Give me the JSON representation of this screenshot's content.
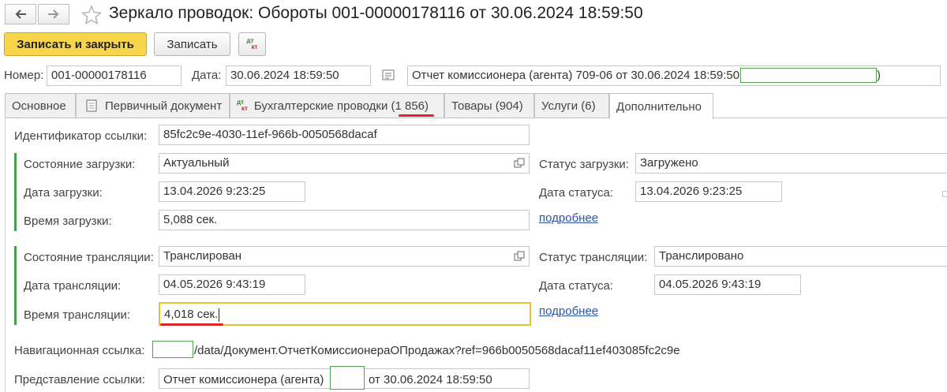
{
  "window": {
    "title": "Зеркало проводок: Обороты 001-00000178116 от 30.06.2024 18:59:50"
  },
  "toolbar": {
    "save_close_label": "Записать и закрыть",
    "save_label": "Записать",
    "dtkt_top": "дт",
    "dtkt_bottom": "кт"
  },
  "header": {
    "number_label": "Номер:",
    "number_value": "001-00000178116",
    "date_label": "Дата:",
    "date_value": "30.06.2024 18:59:50",
    "basis_value": "Отчет комиссионера (агента) 709-06 от 30.06.2024 18:59:50",
    "basis_suffix": ")"
  },
  "tabs": [
    {
      "label": "Основное"
    },
    {
      "label": "Первичный документ"
    },
    {
      "label": "Бухгалтерские проводки (1 856)"
    },
    {
      "label": "Товары (904)"
    },
    {
      "label": "Услуги (6)"
    },
    {
      "label": "Дополнительно"
    }
  ],
  "extra": {
    "ref_id_label": "Идентификатор ссылки:",
    "ref_id_value": "85fc2c9e-4030-11ef-966b-0050568dacaf",
    "load": {
      "state_label": "Состояние загрузки:",
      "state_value": "Актуальный",
      "date_label": "Дата загрузки:",
      "date_value": "13.04.2026  9:23:25",
      "time_label": "Время загрузки:",
      "time_value": "5,088 сек.",
      "status_label": "Статус загрузки:",
      "status_value": "Загружено",
      "status_date_label": "Дата статуса:",
      "status_date_value": "13.04.2026  9:23:25",
      "more_link": "подробнее"
    },
    "translation": {
      "state_label": "Состояние трансляции:",
      "state_value": "Транслирован",
      "date_label": "Дата трансляции:",
      "date_value": "04.05.2026  9:43:19",
      "time_label": "Время трансляции:",
      "time_value": "4,018 сек.",
      "status_label": "Статус трансляции:",
      "status_value": "Транслировано",
      "status_date_label": "Дата статуса:",
      "status_date_value": "04.05.2026  9:43:19",
      "more_link": "подробнее"
    },
    "nav_link_label": "Навигационная ссылка:",
    "nav_link_value": "/data/Документ.ОтчетКомиссионераОПродажах?ref=966b0050568dacaf11ef403085fc2c9e",
    "ref_repr_label": "Представление ссылки:",
    "ref_repr_prefix": "Отчет комиссионера (агента)",
    "ref_repr_suffix": "от 30.06.2024 18:59:50"
  },
  "colors": {
    "primary_button": "#f8d54a",
    "group_bar": "#4a9c4e",
    "active_field_border": "#e8c22c",
    "underline_mark": "#e0222a",
    "link": "#2b54a8"
  }
}
